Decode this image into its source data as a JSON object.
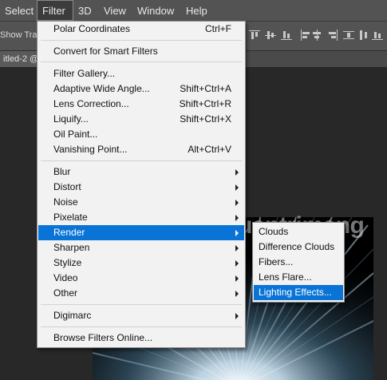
{
  "menubar": {
    "items": [
      {
        "label": "Select",
        "active": false
      },
      {
        "label": "Filter",
        "active": true
      },
      {
        "label": "3D",
        "active": false
      },
      {
        "label": "View",
        "active": false
      },
      {
        "label": "Window",
        "active": false
      },
      {
        "label": "Help",
        "active": false
      }
    ]
  },
  "options_bar": {
    "show_transform_label": "Show Trans"
  },
  "document_tab": {
    "label": "itled-2 @"
  },
  "watermark": {
    "text": "uantrimang"
  },
  "filter_menu": {
    "last_filter": {
      "label": "Polar Coordinates",
      "shortcut": "Ctrl+F"
    },
    "convert_smart": {
      "label": "Convert for Smart Filters"
    },
    "group1": [
      {
        "label": "Filter Gallery...",
        "shortcut": ""
      },
      {
        "label": "Adaptive Wide Angle...",
        "shortcut": "Shift+Ctrl+A"
      },
      {
        "label": "Lens Correction...",
        "shortcut": "Shift+Ctrl+R"
      },
      {
        "label": "Liquify...",
        "shortcut": "Shift+Ctrl+X"
      },
      {
        "label": "Oil Paint...",
        "shortcut": ""
      },
      {
        "label": "Vanishing Point...",
        "shortcut": "Alt+Ctrl+V"
      }
    ],
    "group2": [
      {
        "label": "Blur"
      },
      {
        "label": "Distort"
      },
      {
        "label": "Noise"
      },
      {
        "label": "Pixelate"
      },
      {
        "label": "Render"
      },
      {
        "label": "Sharpen"
      },
      {
        "label": "Stylize"
      },
      {
        "label": "Video"
      },
      {
        "label": "Other"
      }
    ],
    "digimarc": {
      "label": "Digimarc"
    },
    "browse": {
      "label": "Browse Filters Online..."
    },
    "highlighted": "Render"
  },
  "render_submenu": {
    "items": [
      {
        "label": "Clouds"
      },
      {
        "label": "Difference Clouds"
      },
      {
        "label": "Fibers..."
      },
      {
        "label": "Lens Flare..."
      },
      {
        "label": "Lighting Effects..."
      }
    ],
    "highlighted": "Lighting Effects..."
  },
  "colors": {
    "highlight": "#0a74d6",
    "menu_bg": "#f2f2f2",
    "ui_dark": "#535353"
  }
}
